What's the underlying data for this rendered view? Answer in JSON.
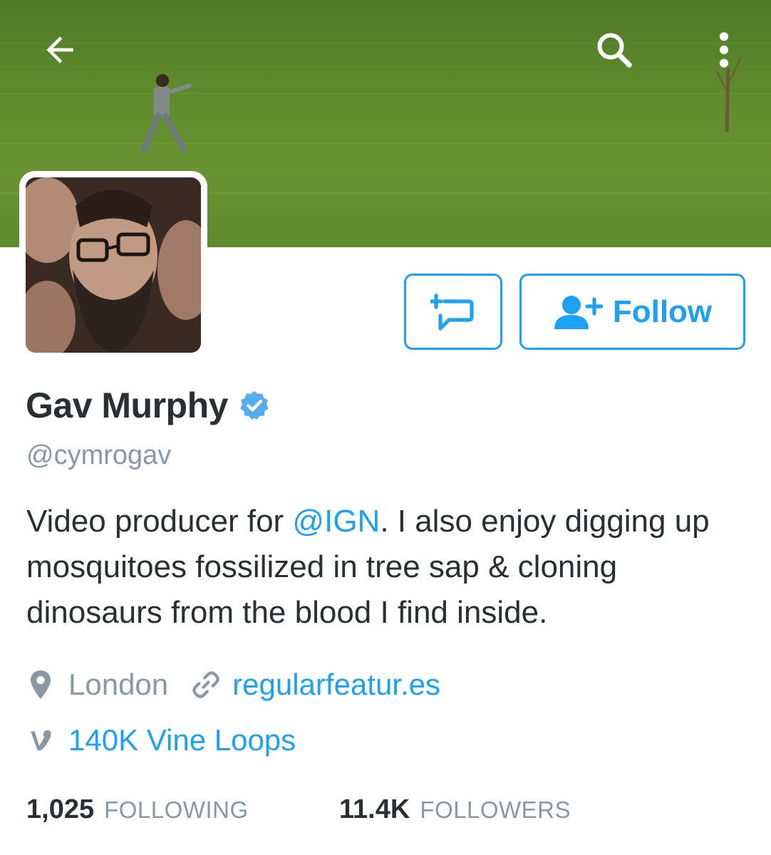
{
  "topbar": {
    "back_icon": "arrow-left-icon",
    "search_icon": "search-icon",
    "overflow_icon": "more-vertical-icon"
  },
  "profile": {
    "name": "Gav Murphy",
    "verified": true,
    "handle": "@cymrogav",
    "bio": {
      "before": "Video producer for ",
      "mention": "@IGN",
      "after": ". I also enjoy digging up mosquitoes fossilized in tree sap & cloning dinosaurs from the blood I find inside."
    },
    "location": "London",
    "website": "regularfeatur.es",
    "vine": "140K Vine Loops"
  },
  "actions": {
    "dm_icon": "new-message-icon",
    "follow_label": "Follow",
    "follow_icon": "add-user-icon"
  },
  "stats": {
    "following_count": "1,025",
    "following_label": "FOLLOWING",
    "followers_count": "11.4K",
    "followers_label": "FOLLOWERS"
  },
  "colors": {
    "accent": "#1da1f2",
    "text": "#292f33",
    "muted": "#8899a6",
    "verified": "#55acee"
  }
}
